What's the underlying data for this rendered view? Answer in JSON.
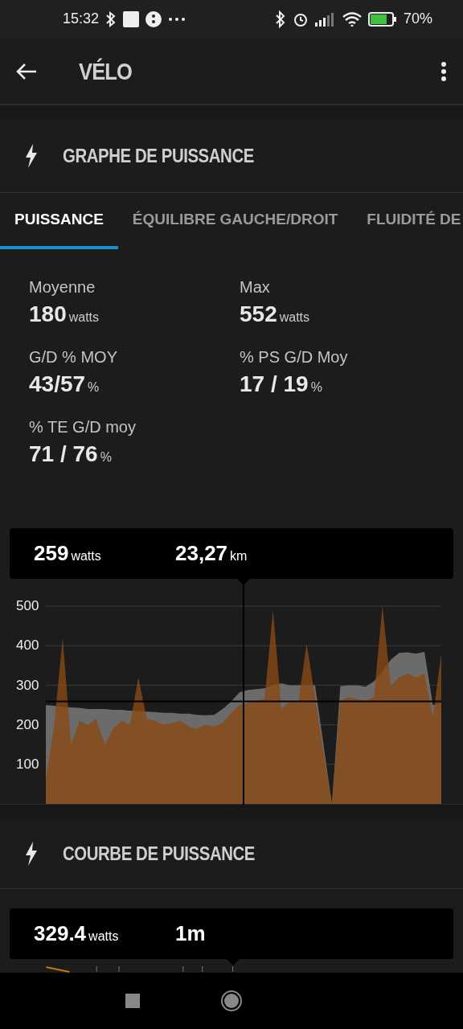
{
  "status_bar": {
    "time": "15:32",
    "battery": "70%"
  },
  "header": {
    "title": "VÉLO"
  },
  "power_graph": {
    "title": "GRAPHE DE PUISSANCE",
    "tabs": [
      {
        "label": "PUISSANCE",
        "selected": true
      },
      {
        "label": "ÉQUILIBRE GAUCHE/DROIT",
        "selected": false
      },
      {
        "label": "FLUIDITÉ DE",
        "selected": false
      }
    ],
    "stats": [
      {
        "label": "Moyenne",
        "value": "180",
        "unit": "watts"
      },
      {
        "label": "Max",
        "value": "552",
        "unit": "watts"
      },
      {
        "label": "G/D % MOY",
        "value": "43/57",
        "unit": "%"
      },
      {
        "label": "% PS G/D Moy",
        "value": "17 / 19",
        "unit": "%"
      },
      {
        "label": "% TE G/D moy",
        "value": "71 / 76",
        "unit": "%"
      }
    ],
    "tooltip": [
      {
        "value": "259",
        "unit": "watts"
      },
      {
        "value": "23,27",
        "unit": "km"
      }
    ],
    "chart_data": {
      "type": "area",
      "grid": true,
      "ylim": [
        0,
        500
      ],
      "yticks": [
        100,
        200,
        300,
        400,
        500
      ],
      "ref_lines": [
        {
          "axis": "y",
          "value": 259
        }
      ],
      "series": [
        {
          "color": "#6b6b6b",
          "values": [
            250,
            248,
            245,
            244,
            243,
            240,
            240,
            240,
            238,
            238,
            236,
            235,
            233,
            232,
            230,
            230,
            228,
            228,
            225,
            224,
            225,
            240,
            258,
            282,
            288,
            290,
            292,
            300,
            305,
            300,
            300,
            300,
            300,
            150,
            0,
            298,
            300,
            300,
            296,
            310,
            335,
            365,
            382,
            383,
            380,
            384,
            250,
            255
          ]
        },
        {
          "color": "#8a4a14",
          "values": [
            60,
            200,
            420,
            150,
            210,
            200,
            215,
            150,
            190,
            210,
            200,
            320,
            215,
            210,
            200,
            205,
            210,
            195,
            190,
            200,
            195,
            205,
            230,
            250,
            255,
            260,
            265,
            490,
            240,
            260,
            255,
            405,
            270,
            130,
            0,
            260,
            270,
            265,
            260,
            270,
            500,
            300,
            320,
            330,
            320,
            330,
            220,
            380
          ]
        }
      ]
    }
  },
  "power_curve": {
    "title": "COURBE DE PUISSANCE",
    "tooltip": [
      {
        "value": "329.4",
        "unit": "watts"
      },
      {
        "value": "1m"
      }
    ]
  }
}
